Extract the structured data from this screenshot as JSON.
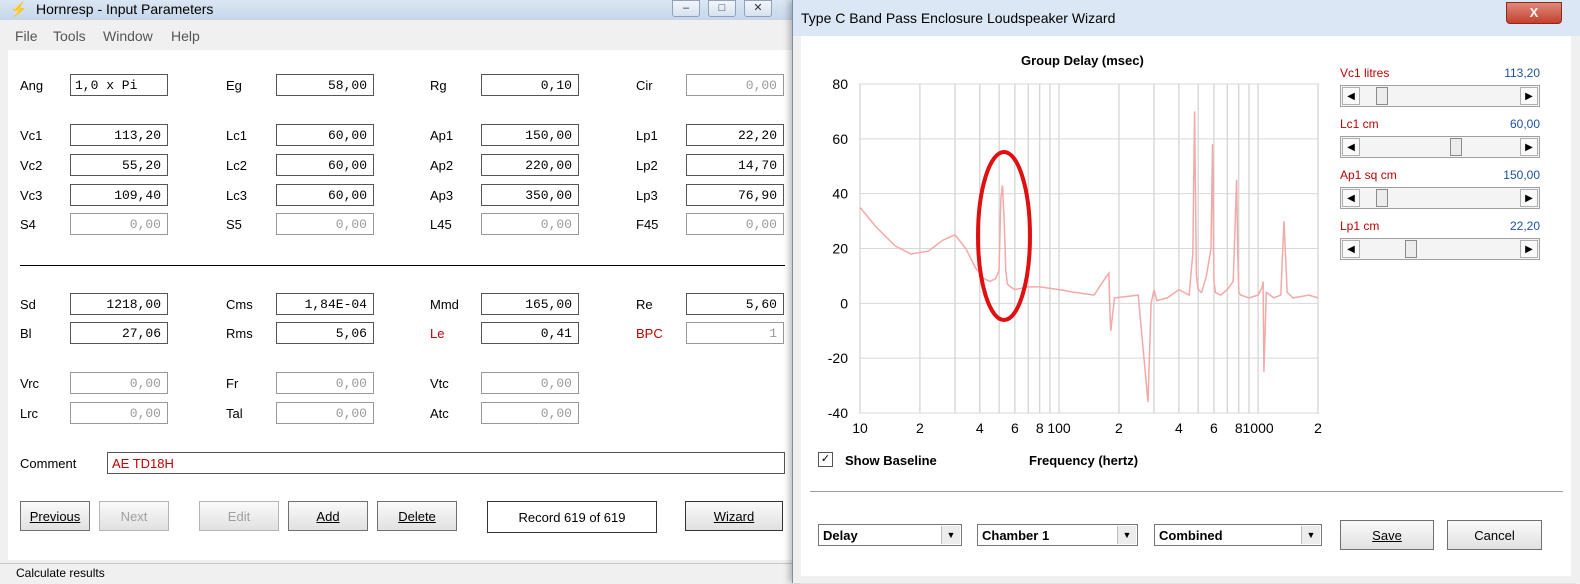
{
  "main_window": {
    "title": "Hornresp - Input Parameters",
    "menu": [
      "File",
      "Tools",
      "Window",
      "Help"
    ],
    "params_top": [
      {
        "label": "Ang",
        "value": "1,0 x Pi",
        "red": false,
        "grey": false
      },
      {
        "label": "Eg",
        "value": "58,00",
        "red": false,
        "grey": false
      },
      {
        "label": "Rg",
        "value": "0,10",
        "red": false,
        "grey": false
      },
      {
        "label": "Cir",
        "value": "0,00",
        "red": false,
        "grey": true
      },
      {
        "label": "Vc1",
        "value": "113,20",
        "red": false,
        "grey": false
      },
      {
        "label": "Lc1",
        "value": "60,00",
        "red": false,
        "grey": false
      },
      {
        "label": "Ap1",
        "value": "150,00",
        "red": false,
        "grey": false
      },
      {
        "label": "Lp1",
        "value": "22,20",
        "red": false,
        "grey": false
      },
      {
        "label": "Vc2",
        "value": "55,20",
        "red": false,
        "grey": false
      },
      {
        "label": "Lc2",
        "value": "60,00",
        "red": false,
        "grey": false
      },
      {
        "label": "Ap2",
        "value": "220,00",
        "red": false,
        "grey": false
      },
      {
        "label": "Lp2",
        "value": "14,70",
        "red": false,
        "grey": false
      },
      {
        "label": "Vc3",
        "value": "109,40",
        "red": false,
        "grey": false
      },
      {
        "label": "Lc3",
        "value": "60,00",
        "red": false,
        "grey": false
      },
      {
        "label": "Ap3",
        "value": "350,00",
        "red": false,
        "grey": false
      },
      {
        "label": "Lp3",
        "value": "76,90",
        "red": false,
        "grey": false
      },
      {
        "label": "S4",
        "value": "0,00",
        "red": false,
        "grey": true
      },
      {
        "label": "S5",
        "value": "0,00",
        "red": false,
        "grey": true
      },
      {
        "label": "L45",
        "value": "0,00",
        "red": false,
        "grey": true
      },
      {
        "label": "F45",
        "value": "0,00",
        "red": false,
        "grey": true
      }
    ],
    "params_driver": [
      {
        "label": "Sd",
        "value": "1218,00",
        "red": false,
        "grey": false
      },
      {
        "label": "Cms",
        "value": "1,84E-04",
        "red": false,
        "grey": false
      },
      {
        "label": "Mmd",
        "value": "165,00",
        "red": false,
        "grey": false
      },
      {
        "label": "Re",
        "value": "5,60",
        "red": false,
        "grey": false
      },
      {
        "label": "Bl",
        "value": "27,06",
        "red": false,
        "grey": false
      },
      {
        "label": "Rms",
        "value": "5,06",
        "red": false,
        "grey": false
      },
      {
        "label": "Le",
        "value": "0,41",
        "red": true,
        "grey": false
      },
      {
        "label": "BPC",
        "value": "1",
        "red": true,
        "grey": true
      }
    ],
    "params_bottom": [
      {
        "label": "Vrc",
        "value": "0,00",
        "red": false,
        "grey": true
      },
      {
        "label": "Fr",
        "value": "0,00",
        "red": false,
        "grey": true
      },
      {
        "label": "Vtc",
        "value": "0,00",
        "red": false,
        "grey": true
      },
      {
        "label": "Lrc",
        "value": "0,00",
        "red": false,
        "grey": true
      },
      {
        "label": "Tal",
        "value": "0,00",
        "red": false,
        "grey": true
      },
      {
        "label": "Atc",
        "value": "0,00",
        "red": false,
        "grey": true
      }
    ],
    "comment_label": "Comment",
    "comment_value": "AE TD18H",
    "buttons": {
      "previous": "Previous",
      "next": "Next",
      "edit": "Edit",
      "add": "Add",
      "delete": "Delete",
      "wizard": "Wizard"
    },
    "record": "Record 619 of 619",
    "status": "Calculate results"
  },
  "wizard": {
    "title": "Type C Band Pass Enclosure Loudspeaker Wizard",
    "close_label": "X",
    "show_baseline_label": "Show Baseline",
    "show_baseline_checked": true,
    "sliders": [
      {
        "label": "Vc1  litres",
        "value": "113,20",
        "position": 0.1
      },
      {
        "label": "Lc1  cm",
        "value": "60,00",
        "position": 0.6
      },
      {
        "label": "Ap1  sq cm",
        "value": "150,00",
        "position": 0.1
      },
      {
        "label": "Lp1  cm",
        "value": "22,20",
        "position": 0.3
      }
    ],
    "combos": [
      "Delay",
      "Chamber 1",
      "Combined"
    ],
    "save_label": "Save",
    "cancel_label": "Cancel",
    "accent_colors": {
      "curve": "#f4a8a8",
      "highlight_ellipse": "#e01010",
      "slider_label": "#c00000",
      "slider_value": "#2050a0"
    }
  },
  "chart_data": {
    "type": "line",
    "title": "Group Delay (msec)",
    "xlabel": "Frequency (hertz)",
    "ylabel": "",
    "x_scale": "log",
    "xlim": [
      10,
      2000
    ],
    "ylim": [
      -40,
      80
    ],
    "y_ticks": [
      "80",
      "60",
      "40",
      "20",
      "0",
      "-20",
      "-40"
    ],
    "x_ticks": [
      "10",
      "2",
      "4",
      "6",
      "8",
      "100",
      "2",
      "4",
      "6",
      "8",
      "1000",
      "2"
    ],
    "grid": true,
    "series": [
      {
        "color": "#f4a8a8",
        "x": [
          10,
          12,
          15,
          18,
          22,
          26,
          30,
          34,
          38,
          42,
          45,
          48,
          50,
          51,
          52,
          53,
          54,
          55,
          57,
          60,
          70,
          80,
          100,
          120,
          150,
          170,
          178,
          180,
          182,
          190,
          250,
          280,
          290,
          300,
          310,
          350,
          400,
          450,
          470,
          480,
          490,
          500,
          520,
          550,
          580,
          590,
          600,
          610,
          650,
          700,
          750,
          780,
          790,
          800,
          820,
          900,
          1000,
          1050,
          1060,
          1070,
          1100,
          1200,
          1300,
          1350,
          1400,
          1500,
          1800,
          2000
        ],
        "y": [
          35,
          28,
          21,
          18,
          19,
          23,
          25,
          20,
          13,
          9,
          8,
          9,
          12,
          38,
          43,
          30,
          12,
          7,
          6,
          5,
          6,
          6,
          5,
          4,
          3,
          9,
          11,
          -3,
          -10,
          2,
          3,
          -36,
          0,
          5,
          1,
          2,
          5,
          3,
          18,
          70,
          10,
          5,
          4,
          10,
          20,
          58,
          8,
          4,
          3,
          5,
          8,
          45,
          20,
          4,
          3,
          2,
          3,
          6,
          8,
          -25,
          4,
          2,
          3,
          30,
          4,
          2,
          3,
          2
        ]
      }
    ]
  }
}
